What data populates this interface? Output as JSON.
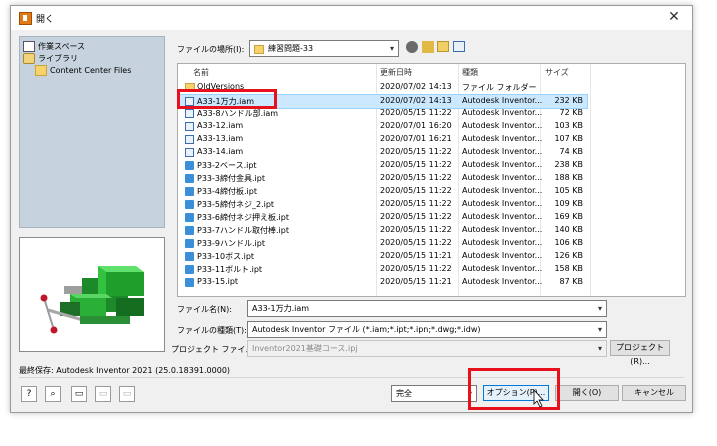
{
  "window": {
    "title": "開く"
  },
  "places": [
    {
      "label": "作業スペース",
      "icon": "workspace-icon"
    },
    {
      "label": "ライブラリ",
      "icon": "library-icon"
    },
    {
      "label": "Content Center Files",
      "icon": "folder-icon"
    }
  ],
  "location": {
    "label": "ファイルの場所(I):",
    "value": "練習問題-33"
  },
  "columns": {
    "name": "名前",
    "date": "更新日時",
    "type": "種類",
    "size": "サイズ"
  },
  "files": [
    {
      "name": "OldVersions",
      "date": "2020/07/02 14:13",
      "type": "ファイル フォルダー",
      "size": "",
      "kind": "folder"
    },
    {
      "name": "A33-1万力.iam",
      "date": "2020/07/02 14:13",
      "type": "Autodesk Inventor...",
      "size": "232 KB",
      "kind": "iam",
      "selected": true
    },
    {
      "name": "A33-8ハンドル部.iam",
      "date": "2020/05/15 11:22",
      "type": "Autodesk Inventor...",
      "size": "72 KB",
      "kind": "iam"
    },
    {
      "name": "A33-12.iam",
      "date": "2020/07/01 16:20",
      "type": "Autodesk Inventor...",
      "size": "103 KB",
      "kind": "iam"
    },
    {
      "name": "A33-13.iam",
      "date": "2020/07/01 16:21",
      "type": "Autodesk Inventor...",
      "size": "107 KB",
      "kind": "iam"
    },
    {
      "name": "A33-14.iam",
      "date": "2020/05/15 11:22",
      "type": "Autodesk Inventor...",
      "size": "74 KB",
      "kind": "iam"
    },
    {
      "name": "P33-2ベース.ipt",
      "date": "2020/05/15 11:22",
      "type": "Autodesk Inventor...",
      "size": "238 KB",
      "kind": "ipt"
    },
    {
      "name": "P33-3締付金具.ipt",
      "date": "2020/05/15 11:22",
      "type": "Autodesk Inventor...",
      "size": "188 KB",
      "kind": "ipt"
    },
    {
      "name": "P33-4締付板.ipt",
      "date": "2020/05/15 11:22",
      "type": "Autodesk Inventor...",
      "size": "105 KB",
      "kind": "ipt"
    },
    {
      "name": "P33-5締付ネジ_2.ipt",
      "date": "2020/05/15 11:22",
      "type": "Autodesk Inventor...",
      "size": "109 KB",
      "kind": "ipt"
    },
    {
      "name": "P33-6締付ネジ押え板.ipt",
      "date": "2020/05/15 11:22",
      "type": "Autodesk Inventor...",
      "size": "169 KB",
      "kind": "ipt"
    },
    {
      "name": "P33-7ハンドル取付棒.ipt",
      "date": "2020/05/15 11:22",
      "type": "Autodesk Inventor...",
      "size": "140 KB",
      "kind": "ipt"
    },
    {
      "name": "P33-9ハンドル.ipt",
      "date": "2020/05/15 11:22",
      "type": "Autodesk Inventor...",
      "size": "106 KB",
      "kind": "ipt"
    },
    {
      "name": "P33-10ボス.ipt",
      "date": "2020/05/15 11:21",
      "type": "Autodesk Inventor...",
      "size": "126 KB",
      "kind": "ipt"
    },
    {
      "name": "P33-11ボルト.ipt",
      "date": "2020/05/15 11:22",
      "type": "Autodesk Inventor...",
      "size": "158 KB",
      "kind": "ipt"
    },
    {
      "name": "P33-15.ipt",
      "date": "2020/05/15 11:21",
      "type": "Autodesk Inventor...",
      "size": "87 KB",
      "kind": "ipt"
    }
  ],
  "filename": {
    "label": "ファイル名(N):",
    "value": "A33-1万力.iam"
  },
  "filetype": {
    "label": "ファイルの種類(T):",
    "value": "Autodesk Inventor ファイル (*.iam;*.ipt;*.ipn;*.dwg;*.idw)"
  },
  "project": {
    "label": "プロジェクト ファイル(J):",
    "value": "Inventor2021基礎コース.ipj",
    "button": "プロジェクト(R)..."
  },
  "last_saved": "最終保存: Autodesk Inventor 2021 (25.0.18391.0000)",
  "mode": {
    "value": "完全"
  },
  "buttons": {
    "options": "オプション(P)...",
    "open": "開く(O)",
    "cancel": "キャンセル"
  },
  "colors": {
    "highlight": "#e8101d",
    "selection": "#cce8ff",
    "places_bg": "#c6d2dd"
  }
}
